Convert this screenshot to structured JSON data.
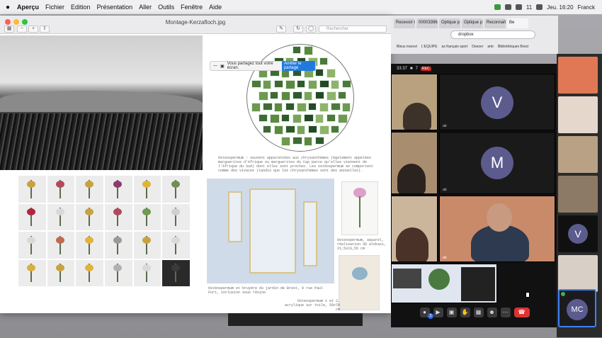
{
  "menubar": {
    "items": [
      "Aperçu",
      "Fichier",
      "Edition",
      "Présentation",
      "Aller",
      "Outils",
      "Fenêtre",
      "Aide"
    ],
    "status": {
      "battery": "11",
      "date_time": "Jeu. 16:20",
      "user": "Franck"
    }
  },
  "preview": {
    "file_name": "Montage-Kerzafloch.jpg",
    "search_placeholder": "Rechercher",
    "share_notice": "Vous partagez tout votre écran.",
    "stop_share_label": "Arrêter le partage",
    "caption_main": "Osteospermum : souvent apparentées aux chrysanthèmes (également appelées marguerites d'Afrique ou marguerites du Cap parce qu'elles viennent de l'Afrique du Sud) dont elles sont proches. Les ostéospermum se comportent comme des vivaces (tandis que les chrysanthèmes sont des annuelles).",
    "caption_specimen": "Osteospermum, aquarel, réalisation 3D alokasi, 21,5x23,55 cm",
    "caption_garden": "Ostéospermum et bruyère du jardin de Brest, 9 rue Paul Fort, inclusion sous résine",
    "caption_canvas": "Osteospermum 1 et 2, acrylique sur toile, 50x70 cm"
  },
  "browser": {
    "tabs": [
      "Recevoir le",
      "00003396",
      "Optique p",
      "Optique p",
      "Reconnaître",
      "Be"
    ],
    "address": "dropbox",
    "bookmarks": [
      "Bleus marcel",
      "L'EQUIPE",
      "as français sport",
      "Deezer",
      "arte",
      "Bibliothèques Brest"
    ]
  },
  "zoom": {
    "timer": "33:37",
    "participants": "7",
    "rec": "REC",
    "avatars": [
      "V",
      "M"
    ],
    "strip_avatar": "V",
    "strip_me": "MC",
    "raise_count": "3",
    "tags": [
      "ab",
      "ab",
      "ab",
      "ab",
      "ab"
    ]
  }
}
